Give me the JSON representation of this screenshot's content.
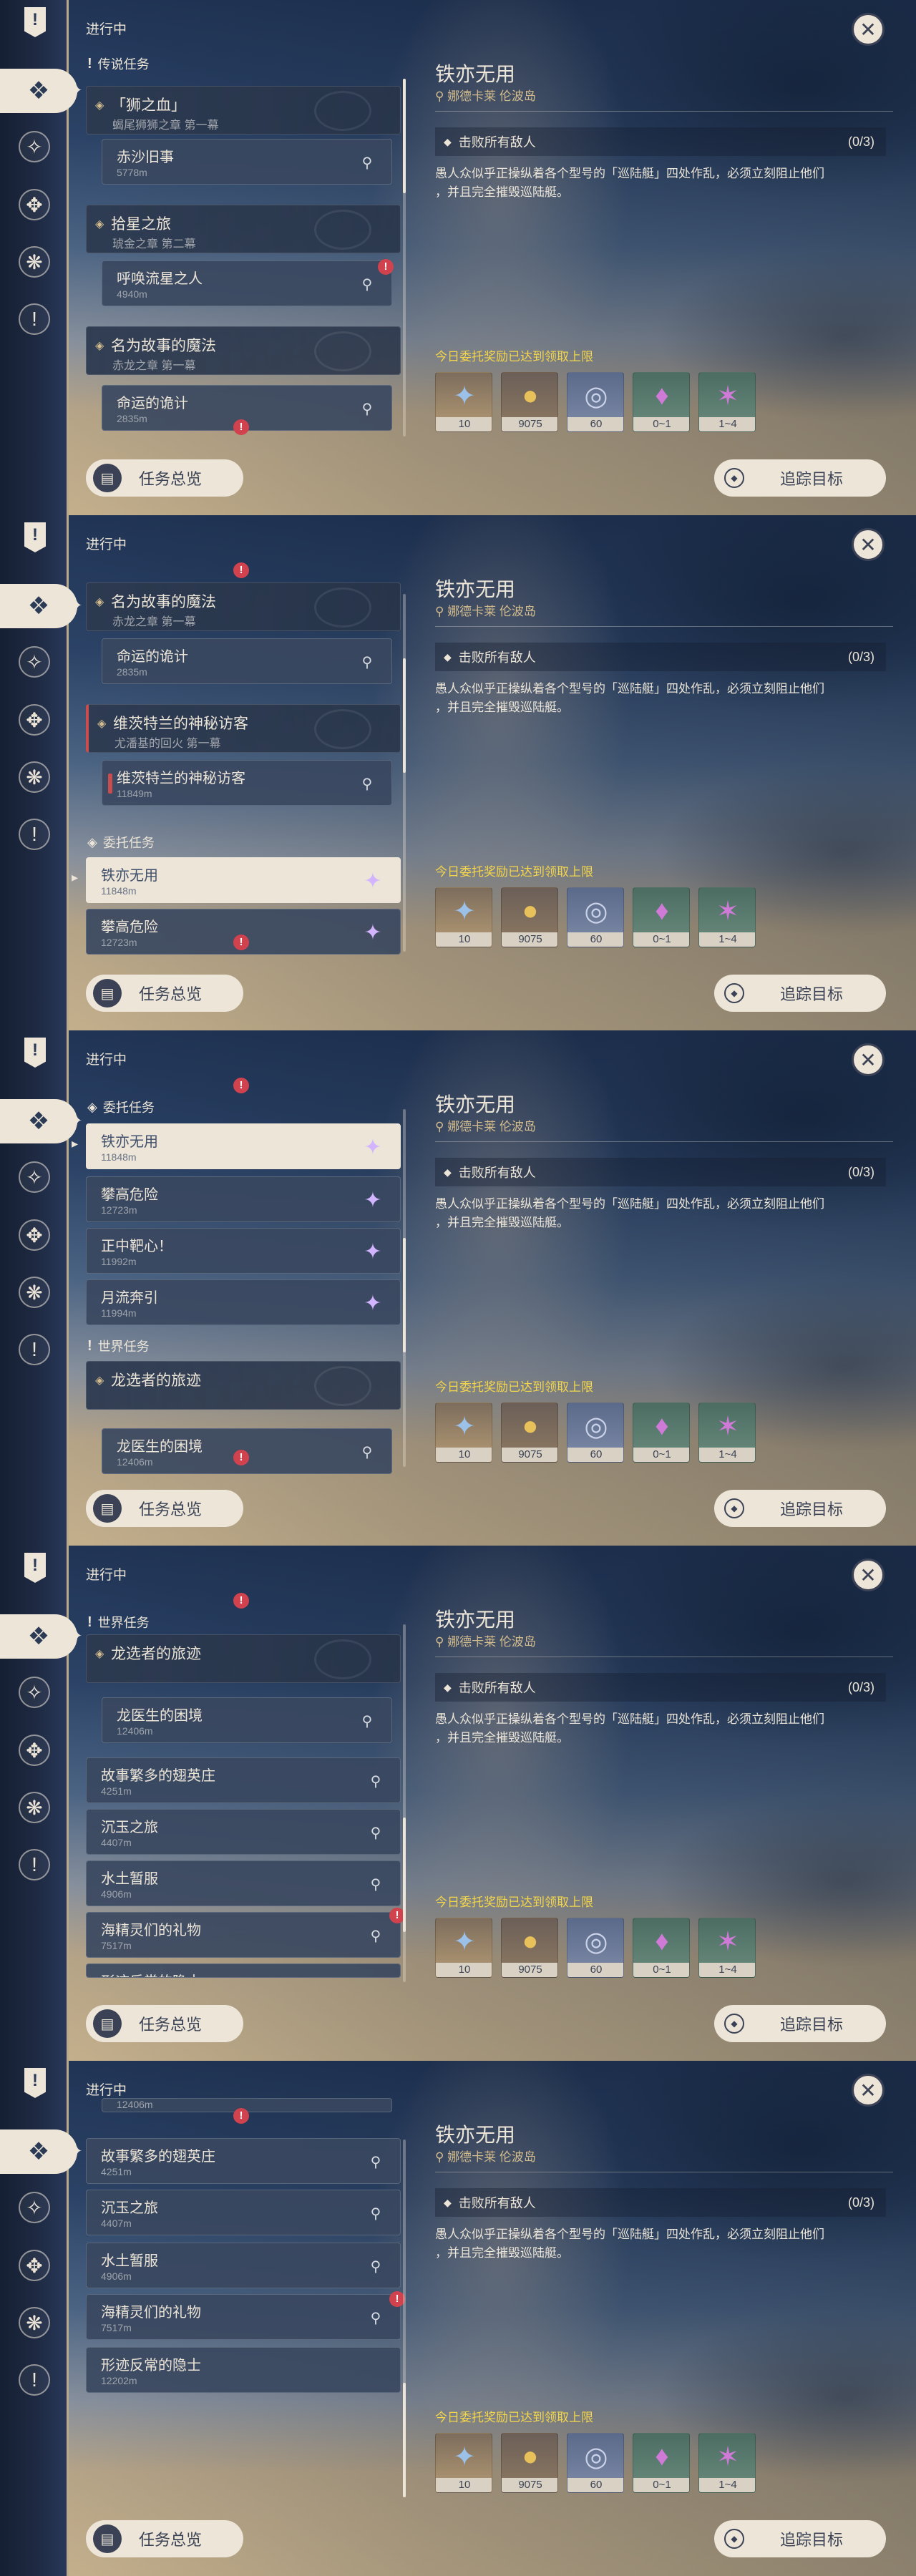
{
  "header": {
    "in_progress": "进行中"
  },
  "categories": {
    "legend": "传说任务",
    "commission": "委托任务",
    "world": "世界任务"
  },
  "quests": {
    "lion": {
      "name": "「狮之血」",
      "sub": "蝎尾狮狮之章 第一幕"
    },
    "desert": {
      "name": "赤沙旧事",
      "dist": "5778m"
    },
    "star": {
      "name": "拾星之旅",
      "sub": "琥金之章 第二幕"
    },
    "falling": {
      "name": "呼唤流星之人",
      "dist": "4940m"
    },
    "magic": {
      "name": "名为故事的魔法",
      "sub": "赤龙之章 第一幕"
    },
    "fate": {
      "name": "命运的诡计",
      "dist": "2835m"
    },
    "visit": {
      "name": "维茨特兰的神秘访客",
      "sub": "尤潘基的回火 第一幕"
    },
    "visit_step": {
      "name": "维茨特兰的神秘访客",
      "dist": "11849m"
    },
    "iron": {
      "name": "铁亦无用",
      "dist": "11848m"
    },
    "climb": {
      "name": "攀高危险",
      "dist": "12723m"
    },
    "bullseye": {
      "name": "正中靶心！",
      "dist": "11992m"
    },
    "moon": {
      "name": "月流奔引",
      "dist": "11994m"
    },
    "dragon": {
      "name": "龙选者的旅迹"
    },
    "doctor": {
      "name": "龙医生的困境",
      "dist": "12406m"
    },
    "hero": {
      "name": "故事繁多的翅英庄",
      "dist": "4251m"
    },
    "jade": {
      "name": "沉玉之旅",
      "dist": "4407m"
    },
    "earth": {
      "name": "水土暂服",
      "dist": "4906m"
    },
    "spirit": {
      "name": "海精灵们的礼物",
      "dist": "7517m"
    },
    "hermit": {
      "name": "形迹反常的隐士",
      "dist": "12202m"
    },
    "hermit_cut": {
      "name": "形迹反常的隐士"
    }
  },
  "detail": {
    "title": "铁亦无用",
    "location": "娜德卡莱 伦波岛",
    "objective": "击败所有敌人",
    "count": "(0/3)",
    "desc_1": "愚人众似乎正操纵着各个型号的「巡陆艇」四处作乱，必须立刻阻止他们",
    "desc_2": "，并且完全摧毁巡陆艇。",
    "cap_note": "今日委托奖励已达到领取上限",
    "rewards": [
      {
        "qty": "10"
      },
      {
        "qty": "9075"
      },
      {
        "qty": "60"
      },
      {
        "qty": "0~1"
      },
      {
        "qty": "1~4"
      }
    ]
  },
  "buttons": {
    "overview": "任务总览",
    "track": "追踪目标"
  },
  "icons": {
    "alert": "!",
    "pin": "⚲",
    "gem": "✦",
    "close": "✕"
  }
}
